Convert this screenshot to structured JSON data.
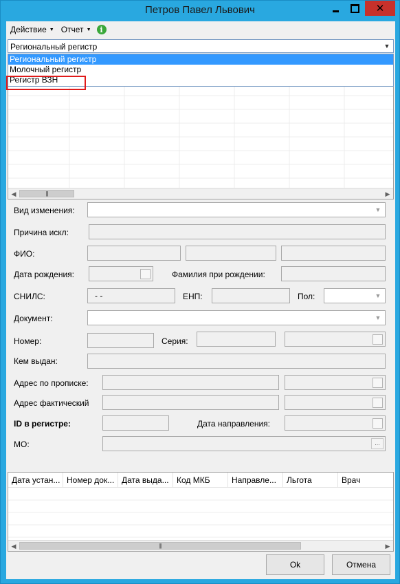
{
  "window": {
    "title": "Петров Павел Львович"
  },
  "menu": {
    "action": "Действие",
    "report": "Отчет"
  },
  "register_combo": {
    "value": "Региональный регистр",
    "options": [
      "Региональный регистр",
      "Молочный регистр",
      "Регистр ВЗН"
    ],
    "selected_index": 0
  },
  "form": {
    "change_type_label": "Вид изменения:",
    "exclusion_reason_label": "Причина искл:",
    "fio_label": "ФИО:",
    "birth_date_label": "Дата рождения:",
    "birth_surname_label": "Фамилия при рождении:",
    "snils_label": "СНИЛС:",
    "snils_value": "-  -",
    "enp_label": "ЕНП:",
    "gender_label": "Пол:",
    "document_label": "Документ:",
    "number_label": "Номер:",
    "series_label": "Серия:",
    "issued_by_label": "Кем выдан:",
    "reg_address_label": "Адрес по прописке:",
    "actual_address_label": "Адрес фактический",
    "registry_id_label": "ID в регистре:",
    "referral_date_label": "Дата направления:",
    "mo_label": "МО:",
    "mo_button": "..."
  },
  "bottom_grid": {
    "columns": [
      "Дата устан...",
      "Номер док...",
      "Дата выда...",
      "Код МКБ",
      "Направле...",
      "Льгота",
      "Врач"
    ]
  },
  "buttons": {
    "ok": "Ok",
    "cancel": "Отмена"
  }
}
